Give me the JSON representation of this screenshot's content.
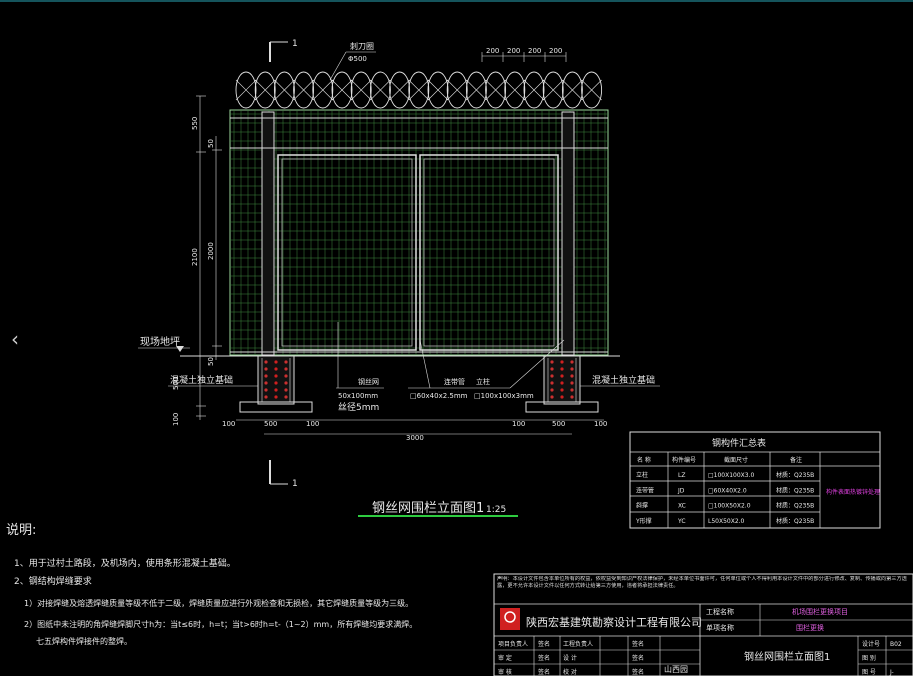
{
  "colors": {
    "background": "#000000",
    "line": "#c8c8c8",
    "mesh": "#7fd07f",
    "dim": "#d8d8d8",
    "accent_magenta": "#e040e0",
    "red": "#d02020"
  },
  "nav": {
    "prev_icon": "‹"
  },
  "section_marker": {
    "number": "1"
  },
  "annotations": {
    "razor_wire": "刺刀圈",
    "razor_dia": "Φ500",
    "ground": "现场地坪",
    "footing_left": "混凝土独立基础",
    "footing_right": "混凝土独立基础",
    "mesh_label": "钢丝网",
    "mesh_spec1": "50x100mm",
    "mesh_spec2": "丝径5mm",
    "rail_label": "连带管",
    "rail_spec": "□60x40x2.5mm",
    "post_label": "立柱",
    "post_spec": "□100x100x3mm"
  },
  "dimensions": {
    "top": [
      "200",
      "200",
      "200",
      "200"
    ],
    "left_outer": [
      "550",
      "2100",
      "500",
      "100"
    ],
    "left_inner": [
      "50",
      "2000",
      "50"
    ],
    "bottom": [
      "100",
      "500",
      "100",
      "100",
      "500",
      "100"
    ],
    "total": "3000"
  },
  "title": {
    "text": "钢丝网围栏立面图1",
    "scale": "1:25"
  },
  "table": {
    "title": "钢构件汇总表",
    "headers": [
      "名 称",
      "构件编号",
      "截面尺寸",
      "备注"
    ],
    "rows": [
      [
        "立柱",
        "LZ",
        "□100X100X3.0",
        "材质：Q235B"
      ],
      [
        "连带管",
        "JD",
        "□60X40X2.0",
        "材质：Q235B"
      ],
      [
        "斜撑",
        "XC",
        "□100X50X2.0",
        "材质：Q235B"
      ],
      [
        "Y形撑",
        "YC",
        "L50X50X2.0",
        "材质：Q235B"
      ]
    ],
    "side_note": "构件表面热镀锌处理"
  },
  "notes": {
    "heading": "说明:",
    "lines": [
      "1、用于过村土路段，及机场内，使用条形混凝土基础。",
      "2、钢结构焊缝要求",
      "1）对接焊缝及熔透焊缝质量等级不低于二级，焊缝质量应进行外观检查和无损检，其它焊缝质量等级为三级。",
      "2）图纸中未注明的角焊缝焊脚尺寸h为：当t≤6时，h=t；当t>6时h=t-（1~2）mm，所有焊缝均要求满焊。",
      "七五焊构件焊接件的整焊。"
    ]
  },
  "titleblock": {
    "statement": "声明：本设计文件包含本单位所有的权益，依权益受到知识产权法律保护，未经本单位书面许可，任何单位或个人不得利用本设计文件中的部分进行修改、复制、传播或向第三方透露，更不允许本设计文件以任何方式转让给第三方使用，违者将承担法律责任。",
    "company": "陕西宏基建筑勘察设计工程有限公司",
    "project_label": "工程名称",
    "project_value": "机场围栏更换项目",
    "subproject_label": "单项名称",
    "subproject_value": "围栏更换",
    "drawing_title": "钢丝网围栏立面图1",
    "rows": [
      [
        "项目负责人",
        "签名",
        "工程负责人",
        "签名"
      ],
      [
        "审 定",
        "签名",
        "设 计",
        "签名"
      ],
      [
        "审 核",
        "签名",
        "校 对",
        "签名"
      ]
    ],
    "right_labels": [
      "设计号",
      "图 别",
      "图 号"
    ],
    "right_values": [
      "B02",
      "",
      "J-"
    ],
    "signature_label": "山西园"
  }
}
